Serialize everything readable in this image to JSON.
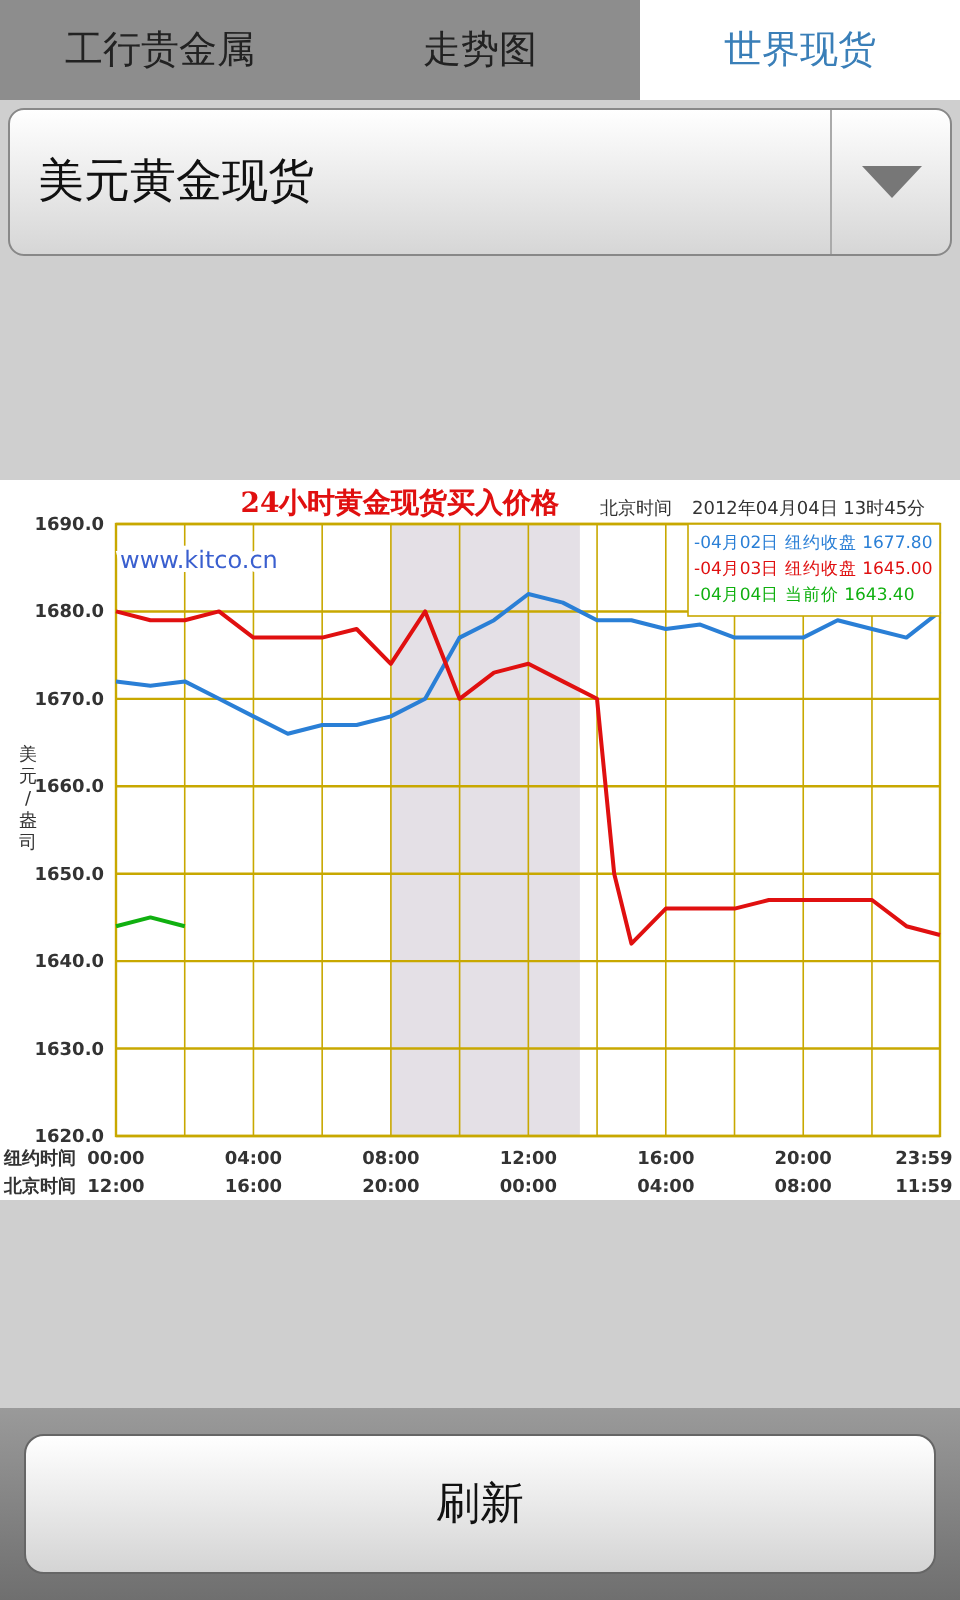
{
  "tabs": [
    {
      "label": "工行贵金属",
      "selected": false
    },
    {
      "label": "走势图",
      "selected": false
    },
    {
      "label": "世界现货",
      "selected": true
    }
  ],
  "dropdown": {
    "value": "美元黄金现货"
  },
  "chart": {
    "source": "www.kitco.cn",
    "timezone": "北京时间",
    "timestamp": "2012年04月04日 13时45分",
    "row_label_1": "纽约时间",
    "row_label_2": "北京时间",
    "secondary_ticks": [
      "12:00",
      "16:00",
      "20:00",
      "00:00",
      "04:00",
      "08:00",
      "11:59"
    ],
    "chart_data": {
      "type": "line",
      "title": "24小时黄金现货买入价格",
      "ylabel": "美元/盎司",
      "x": [
        0,
        1,
        2,
        3,
        4,
        5,
        6,
        7,
        8,
        9,
        10,
        11,
        12,
        13,
        14,
        14.5,
        15,
        16,
        17,
        18,
        19,
        20,
        21,
        22,
        23,
        23.98
      ],
      "xlim": [
        0,
        23.98
      ],
      "grid": true,
      "ylim": [
        1620,
        1690
      ],
      "xticks": [
        {
          "value": 0,
          "label": "00:00"
        },
        {
          "value": 4,
          "label": "04:00"
        },
        {
          "value": 8,
          "label": "08:00"
        },
        {
          "value": 12,
          "label": "12:00"
        },
        {
          "value": 16,
          "label": "16:00"
        },
        {
          "value": 20,
          "label": "20:00"
        },
        {
          "value": 23.98,
          "label": "23:59"
        }
      ],
      "yticks": [
        {
          "value": 1690,
          "label": "1690.0"
        },
        {
          "value": 1680,
          "label": "1680.0"
        },
        {
          "value": 1670,
          "label": "1670.0"
        },
        {
          "value": 1660,
          "label": "1660.0"
        },
        {
          "value": 1650,
          "label": "1650.0"
        },
        {
          "value": 1640,
          "label": "1640.0"
        },
        {
          "value": 1630,
          "label": "1630.0"
        },
        {
          "value": 1620,
          "label": "1620.0"
        }
      ],
      "series": [
        {
          "name": "-04月02日 纽约收盘 1677.80",
          "color": "#2a7fd6",
          "values": [
            1672,
            1671.5,
            1672,
            1670,
            1668,
            1666,
            1667,
            1667,
            1668,
            1670,
            1677,
            1679,
            1682,
            1681,
            1679,
            1679,
            1679,
            1678,
            1678.5,
            1677,
            1677,
            1677,
            1679,
            1678,
            1677,
            1680
          ]
        },
        {
          "name": "-04月03日 纽约收盘 1645.00",
          "color": "#e01010",
          "values": [
            1680,
            1679,
            1679,
            1680,
            1677,
            1677,
            1677,
            1678,
            1674,
            1680,
            1670,
            1673,
            1674,
            1672,
            1670,
            1650,
            1642,
            1646,
            1646,
            1646,
            1647,
            1647,
            1647,
            1647,
            1644,
            1643
          ]
        },
        {
          "name": "-04月04日 当前价 1643.40",
          "color": "#10b010",
          "values": [
            1644,
            1645,
            1644,
            null,
            null,
            null,
            null,
            null,
            null,
            null,
            null,
            null,
            null,
            null,
            null,
            null,
            null,
            null,
            null,
            null,
            null,
            null,
            null,
            null,
            null,
            null
          ]
        }
      ]
    }
  },
  "refresh_button": "刷新"
}
